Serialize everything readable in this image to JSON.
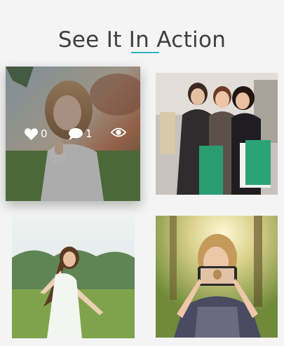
{
  "section": {
    "title": "See It In Action"
  },
  "gallery": {
    "items": [
      {
        "scene": "girl-eating-ice-cream",
        "hovered": true,
        "likes": "0",
        "comments": "1"
      },
      {
        "scene": "friends-shopping"
      },
      {
        "scene": "girl-in-meadow"
      },
      {
        "scene": "girl-taking-selfie"
      }
    ]
  },
  "icons": {
    "likes": "heart-icon",
    "comments": "comment-icon",
    "views": "eye-icon"
  },
  "colors": {
    "accent": "#2fb3c6",
    "title": "#3f3f3f",
    "background": "#f4f4f4"
  }
}
